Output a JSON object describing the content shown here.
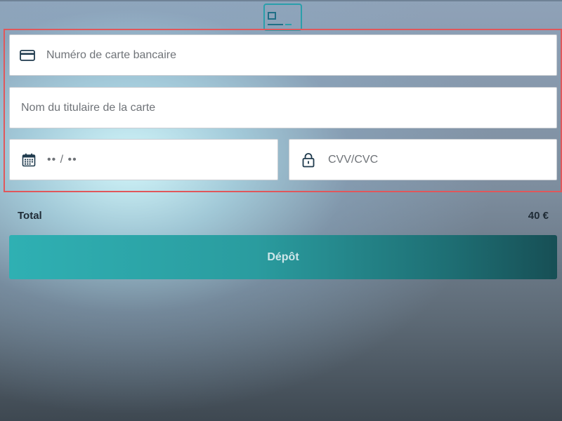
{
  "payment_form": {
    "card_number": {
      "placeholder": "Numéro de carte bancaire",
      "value": "",
      "icon": "credit-card-icon"
    },
    "cardholder_name": {
      "placeholder": "Nom du titulaire de la carte",
      "value": ""
    },
    "expiry": {
      "placeholder": "•• / ••",
      "value": "",
      "icon": "calendar-icon"
    },
    "cvv": {
      "placeholder": "CVV/CVC",
      "value": "",
      "icon": "lock-icon"
    },
    "highlight_color": "#e0575b"
  },
  "summary": {
    "total_label": "Total",
    "total_value": "40 €"
  },
  "actions": {
    "deposit_label": "Dépôt",
    "accent_color": "#2a9c9f"
  },
  "header": {
    "icon": "card-logo-icon"
  }
}
